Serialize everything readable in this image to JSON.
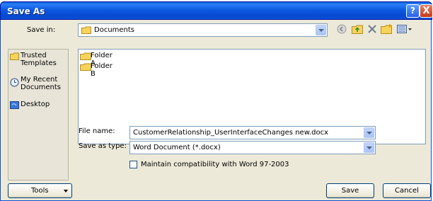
{
  "window": {
    "title": "Save As",
    "help_glyph": "?",
    "close_glyph": "X"
  },
  "save_in": {
    "label": "Save in:",
    "value": "Documents"
  },
  "places": [
    {
      "label": "Trusted Templates",
      "icon": "folder-icon"
    },
    {
      "label": "My Recent Documents",
      "icon": "recent-documents-icon"
    },
    {
      "label": "Desktop",
      "icon": "desktop-icon"
    }
  ],
  "files": [
    {
      "name": "Folder A"
    },
    {
      "name": "Folder B"
    }
  ],
  "file_name": {
    "label": "File name:",
    "value": "CustomerRelationship_UserInterfaceChanges new.docx"
  },
  "save_as_type": {
    "label": "Save as type:",
    "value": "Word Document (*.docx)"
  },
  "compat": {
    "label": "Maintain compatibility with Word 97-2003",
    "checked": false
  },
  "buttons": {
    "tools": "Tools",
    "save": "Save",
    "cancel": "Cancel"
  },
  "toolbar_icons": [
    "back-icon",
    "up-folder-icon",
    "delete-icon",
    "new-folder-icon",
    "views-icon"
  ]
}
